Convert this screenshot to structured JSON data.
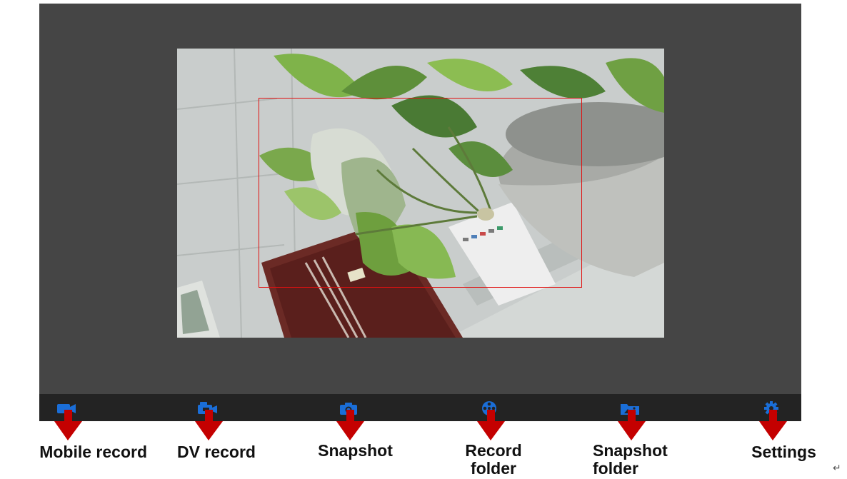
{
  "accent_color": "#1a6ed8",
  "arrow_color": "#c40000",
  "detection_box_color": "#e01010",
  "toolbar": {
    "buttons": [
      {
        "id": "mobile-record",
        "icon": "video-camera-icon",
        "label": "Mobile record"
      },
      {
        "id": "dv-record",
        "icon": "dv-camera-icon",
        "label": "DV record"
      },
      {
        "id": "snapshot",
        "icon": "camera-icon",
        "label": "Snapshot"
      },
      {
        "id": "record-folder",
        "icon": "film-reel-icon",
        "label": "Record\nfolder"
      },
      {
        "id": "snapshot-folder",
        "icon": "photo-folder-icon",
        "label": "Snapshot\nfolder"
      },
      {
        "id": "settings",
        "icon": "gear-icon",
        "label": "Settings"
      }
    ]
  },
  "trailing_mark": "↵"
}
